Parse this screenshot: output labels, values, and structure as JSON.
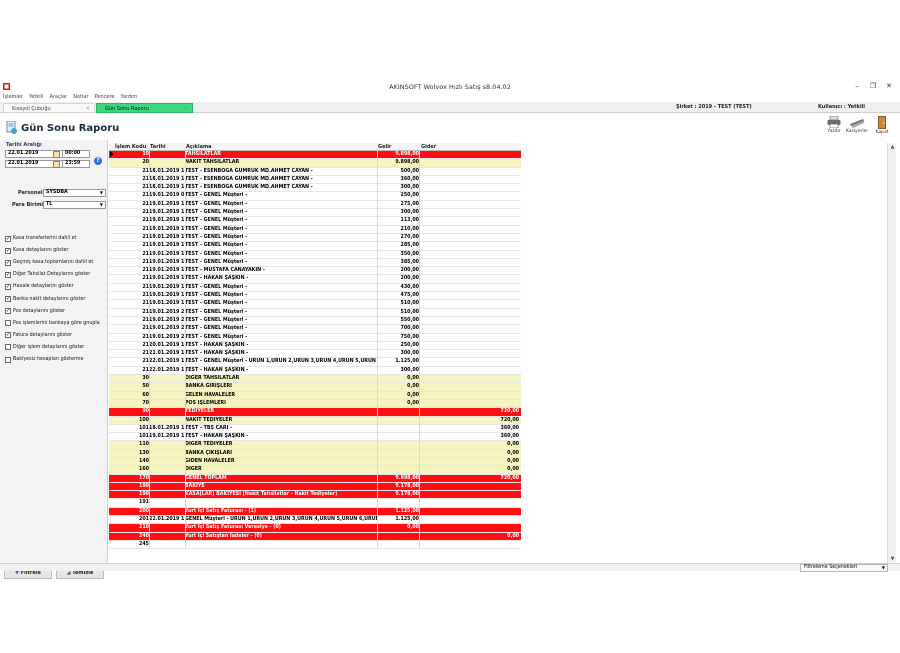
{
  "window": {
    "title": "AKINSOFT Wolvox Hızlı Satış s8.04.02"
  },
  "menu": [
    "İşlemler",
    "Yetkili",
    "Araçlar",
    "Notlar",
    "Pencere",
    "Yardım"
  ],
  "tabs": [
    {
      "label": "Kısayol Çubuğu",
      "close": "×"
    },
    {
      "label": "Gün Sonu Raporu",
      "close": "×"
    }
  ],
  "company": "Şirket : 2019 - TEST (TEST)",
  "user": "Kullanıcı : Yetkili",
  "report_title": "Gün Sonu Raporu",
  "toolbar": {
    "print": "Yazdır",
    "cashiers": "Kasiyerler",
    "close": "Kapat"
  },
  "filters": {
    "date_range_label": "Tarihi Aralığı",
    "start_date": "22.01.2019",
    "start_time": "00:00",
    "end_date": "22.01.2019",
    "end_time": "23:59",
    "help": "?",
    "personnel_label": "Personel",
    "personnel_value": "SYSDBA",
    "currency_label": "Para Birimi",
    "currency_value": "TL",
    "checkboxes": [
      {
        "label": "Kasa transferlerini dahil et",
        "checked": true
      },
      {
        "label": "Kasa detaylarını göster",
        "checked": true
      },
      {
        "label": "Geçmiş kasa toplamlarını dahil et",
        "checked": true
      },
      {
        "label": "Diğer Tahsilat Detaylarını göster",
        "checked": true
      },
      {
        "label": "Havale detaylarını göster",
        "checked": true
      },
      {
        "label": "Banka nakit detaylarını göster",
        "checked": true
      },
      {
        "label": "Pos detaylarını göster",
        "checked": true
      },
      {
        "label": "Pos işlemlerini bankaya göre gnupla",
        "checked": false
      },
      {
        "label": "Fatura detaylarını göster",
        "checked": true
      },
      {
        "label": "Diğer işlem detaylarını göster",
        "checked": false
      },
      {
        "label": "Bakiyesiz hesapları gösterme",
        "checked": false
      }
    ],
    "filter_button": "Filtrele",
    "clear_button": "Temizle"
  },
  "grid": {
    "headers": {
      "code": "İşlem Kodu",
      "date": "Tarihi",
      "desc": "Açıklama",
      "income": "Gelir",
      "expense": "Gider"
    },
    "rows": [
      {
        "style": "red",
        "code": "10",
        "date": "",
        "desc": "TAHSİLATLAR",
        "income": "9.898,00",
        "expense": ""
      },
      {
        "style": "yellow",
        "code": "20",
        "date": "",
        "desc": "NAKİT TAHSİLATLAR",
        "income": "9.898,00",
        "expense": ""
      },
      {
        "style": "white",
        "code": "21",
        "date": "18.01.2019 1",
        "desc": "TEST - ESENBOĞA GÜMRÜK MD.AHMET CAYAN -",
        "income": "500,00",
        "expense": ""
      },
      {
        "style": "white",
        "code": "21",
        "date": "18.01.2019 1",
        "desc": "TEST - ESENBOĞA GÜMRÜK MD.AHMET CAYAN -",
        "income": "360,00",
        "expense": ""
      },
      {
        "style": "white",
        "code": "21",
        "date": "18.01.2019 1",
        "desc": "TEST - ESENBOĞA GÜMRÜK MD.AHMET CAYAN -",
        "income": "300,00",
        "expense": ""
      },
      {
        "style": "white",
        "code": "21",
        "date": "19.01.2019 0",
        "desc": "TEST - GENEL Müşteri -",
        "income": "250,00",
        "expense": ""
      },
      {
        "style": "white",
        "code": "21",
        "date": "19.01.2019 1",
        "desc": "TEST - GENEL Müşteri -",
        "income": "275,00",
        "expense": ""
      },
      {
        "style": "white",
        "code": "21",
        "date": "19.01.2019 1",
        "desc": "TEST - GENEL Müşteri -",
        "income": "300,00",
        "expense": ""
      },
      {
        "style": "white",
        "code": "21",
        "date": "19.01.2019 1",
        "desc": "TEST - GENEL Müşteri -",
        "income": "113,00",
        "expense": ""
      },
      {
        "style": "white",
        "code": "21",
        "date": "19.01.2019 1",
        "desc": "TEST - GENEL Müşteri -",
        "income": "210,00",
        "expense": ""
      },
      {
        "style": "white",
        "code": "21",
        "date": "19.01.2019 1",
        "desc": "TEST - GENEL Müşteri -",
        "income": "270,00",
        "expense": ""
      },
      {
        "style": "white",
        "code": "21",
        "date": "19.01.2019 1",
        "desc": "TEST - GENEL Müşteri -",
        "income": "285,00",
        "expense": ""
      },
      {
        "style": "white",
        "code": "21",
        "date": "19.01.2019 1",
        "desc": "TEST - GENEL Müşteri -",
        "income": "350,00",
        "expense": ""
      },
      {
        "style": "white",
        "code": "21",
        "date": "19.01.2019 1",
        "desc": "TEST - GENEL Müşteri -",
        "income": "385,00",
        "expense": ""
      },
      {
        "style": "white",
        "code": "21",
        "date": "19.01.2019 1",
        "desc": "TEST - MUSTAFA CANAYAKIN -",
        "income": "200,00",
        "expense": ""
      },
      {
        "style": "white",
        "code": "21",
        "date": "19.01.2019 1",
        "desc": "TEST - HAKAN ŞAŞKIN -",
        "income": "200,00",
        "expense": ""
      },
      {
        "style": "white",
        "code": "21",
        "date": "19.01.2019 1",
        "desc": "TEST - GENEL Müşteri -",
        "income": "430,00",
        "expense": ""
      },
      {
        "style": "white",
        "code": "21",
        "date": "19.01.2019 1",
        "desc": "TEST - GENEL Müşteri -",
        "income": "475,00",
        "expense": ""
      },
      {
        "style": "white",
        "code": "21",
        "date": "19.01.2019 1",
        "desc": "TEST - GENEL Müşteri -",
        "income": "510,00",
        "expense": ""
      },
      {
        "style": "white",
        "code": "21",
        "date": "19.01.2019 2",
        "desc": "TEST - GENEL Müşteri -",
        "income": "510,00",
        "expense": ""
      },
      {
        "style": "white",
        "code": "21",
        "date": "19.01.2019 2",
        "desc": "TEST - GENEL Müşteri -",
        "income": "550,00",
        "expense": ""
      },
      {
        "style": "white",
        "code": "21",
        "date": "19.01.2019 2",
        "desc": "TEST - GENEL Müşteri -",
        "income": "700,00",
        "expense": ""
      },
      {
        "style": "white",
        "code": "21",
        "date": "19.01.2019 2",
        "desc": "TEST - GENEL Müşteri -",
        "income": "750,00",
        "expense": ""
      },
      {
        "style": "white",
        "code": "21",
        "date": "20.01.2019 1",
        "desc": "TEST - HAKAN ŞAŞKIN -",
        "income": "250,00",
        "expense": ""
      },
      {
        "style": "white",
        "code": "21",
        "date": "21.01.2019 1",
        "desc": "TEST - HAKAN ŞAŞKIN -",
        "income": "300,00",
        "expense": ""
      },
      {
        "style": "white",
        "code": "21",
        "date": "22.01.2019 1",
        "desc": "TEST - GENEL Müşteri - ÜRÜN 1,ÜRÜN 2,ÜRÜN 3,ÜRÜN 4,ÜRÜN 5,ÜRÜN 6,ÜR",
        "income": "1.125,00",
        "expense": ""
      },
      {
        "style": "white",
        "code": "21",
        "date": "22.01.2019 1",
        "desc": "TEST - HAKAN ŞAŞKIN -",
        "income": "300,00",
        "expense": ""
      },
      {
        "style": "yellow",
        "code": "30",
        "date": "",
        "desc": "DİĞER TAHSİLATLAR",
        "income": "0,00",
        "expense": ""
      },
      {
        "style": "yellow",
        "code": "50",
        "date": "",
        "desc": "BANKA GİRİŞLERİ",
        "income": "0,00",
        "expense": ""
      },
      {
        "style": "yellow",
        "code": "60",
        "date": "",
        "desc": "GELEN HAVALELER",
        "income": "0,00",
        "expense": ""
      },
      {
        "style": "yellow",
        "code": "70",
        "date": "",
        "desc": "POS İŞLEMLERİ",
        "income": "0,00",
        "expense": ""
      },
      {
        "style": "red",
        "code": "90",
        "date": "",
        "desc": "TEDİYELER",
        "income": "",
        "expense": "720,00"
      },
      {
        "style": "yellow",
        "code": "100",
        "date": "",
        "desc": "NAKİT TEDİYELER",
        "income": "",
        "expense": "720,00"
      },
      {
        "style": "white",
        "code": "101",
        "date": "18.01.2019 1",
        "desc": "TEST - TBS CARİ -",
        "income": "",
        "expense": "360,00"
      },
      {
        "style": "white",
        "code": "101",
        "date": "19.01.2019 1",
        "desc": "TEST - HAKAN ŞAŞKIN -",
        "income": "",
        "expense": "360,00"
      },
      {
        "style": "yellow",
        "code": "110",
        "date": "",
        "desc": "DİĞER TEDİYELER",
        "income": "",
        "expense": "0,00"
      },
      {
        "style": "yellow",
        "code": "130",
        "date": "",
        "desc": "BANKA ÇIKIŞLARI",
        "income": "",
        "expense": "0,00"
      },
      {
        "style": "yellow",
        "code": "140",
        "date": "",
        "desc": "GİDEN HAVALELER",
        "income": "",
        "expense": "0,00"
      },
      {
        "style": "yellow",
        "code": "160",
        "date": "",
        "desc": "DİĞER",
        "income": "",
        "expense": "0,00"
      },
      {
        "style": "red",
        "code": "170",
        "date": "",
        "desc": "GENEL TOPLAM",
        "income": "9.898,00",
        "expense": "720,00"
      },
      {
        "style": "red",
        "code": "180",
        "date": "",
        "desc": "BAKİYE",
        "income": "9.178,00",
        "expense": ""
      },
      {
        "style": "red",
        "code": "190",
        "date": "",
        "desc": "KASA(LAR) BAKİYESİ (Nakit Tahsilatlar - Nakit Tediyeler)",
        "income": "9.178,00",
        "expense": ""
      },
      {
        "style": "white",
        "code": "191",
        "date": "",
        "desc": "",
        "income": "",
        "expense": ""
      },
      {
        "style": "red",
        "code": "200",
        "date": "",
        "desc": "Yurt İçi Satış Faturası - (1)",
        "income": "1.125,00",
        "expense": ""
      },
      {
        "style": "white",
        "code": "201",
        "date": "22.01.2019 1",
        "desc": "GENEL Müşteri - ÜRÜN 1,ÜRÜN 2,ÜRÜN 3,ÜRÜN 4,ÜRÜN 5,ÜRÜN 6,ÜRÜN 7,",
        "income": "1.125,00",
        "expense": ""
      },
      {
        "style": "red",
        "code": "210",
        "date": "",
        "desc": "Yurt İçi Satış Faturası Veresiye - (0)",
        "income": "0,00",
        "expense": ""
      },
      {
        "style": "red",
        "code": "240",
        "date": "",
        "desc": "Yurt İçi Satıştan İadeler - (0)",
        "income": "",
        "expense": "0,00"
      },
      {
        "style": "white",
        "code": "245",
        "date": "",
        "desc": "",
        "income": "",
        "expense": ""
      }
    ]
  },
  "status": {
    "filter_options": "Filtreleme Seçenekleri"
  },
  "icons": {
    "app": "app-icon",
    "report": "report-icon",
    "print": "printer-icon",
    "cashiers": "cashier-icon",
    "close": "exit-door-icon"
  }
}
